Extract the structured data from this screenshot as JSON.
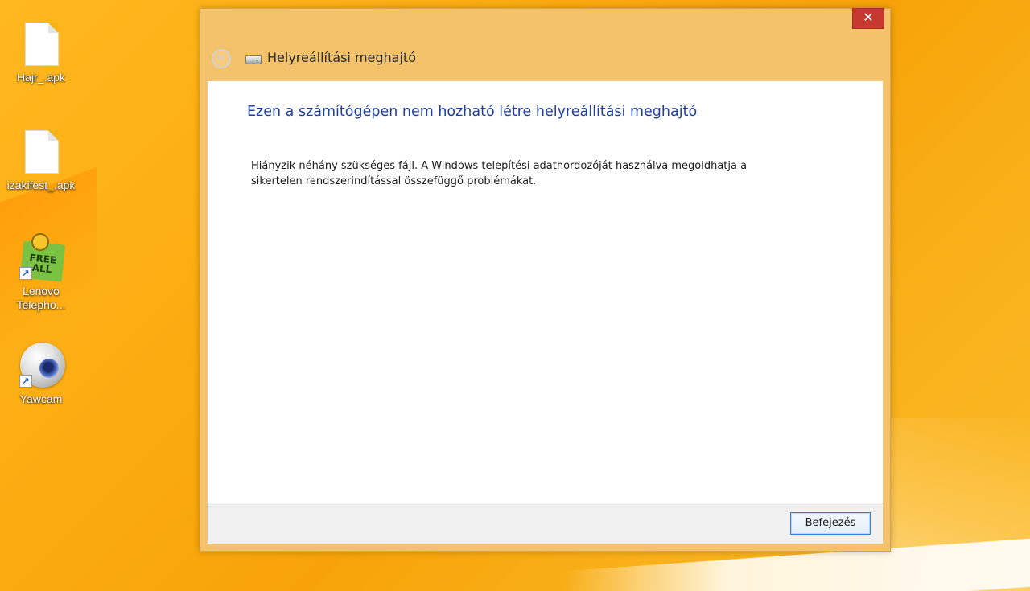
{
  "desktop": {
    "icons": [
      {
        "label": "Hajr_.apk",
        "icon": "file-icon"
      },
      {
        "label": "izakifest_.apk",
        "icon": "file-icon"
      },
      {
        "label_line1": "Lenovo",
        "label_line2": "Telepho...",
        "icon": "free-all-app-icon",
        "badge_text": "FREE ALL",
        "shortcut": true
      },
      {
        "label": "Yawcam",
        "icon": "webcam-icon",
        "shortcut": true
      }
    ]
  },
  "window": {
    "title": "Helyreállítási meghajtó",
    "close_glyph": "✕",
    "back_glyph": "←",
    "heading": "Ezen a számítógépen nem hozható létre helyreállítási meghajtó",
    "body_line1": "Hiányzik néhány szükséges fájl. A Windows telepítési adathordozóját használva megoldhatja a",
    "body_line2": "sikertelen rendszerindítással összefüggő problémákat.",
    "finish_label": "Befejezés"
  },
  "colors": {
    "desktop_bg": "#fbab10",
    "window_frame": "#f3c26b",
    "heading_text": "#1e3f9e",
    "close_button": "#c7382e",
    "button_focus_border": "#3c7fd8"
  }
}
